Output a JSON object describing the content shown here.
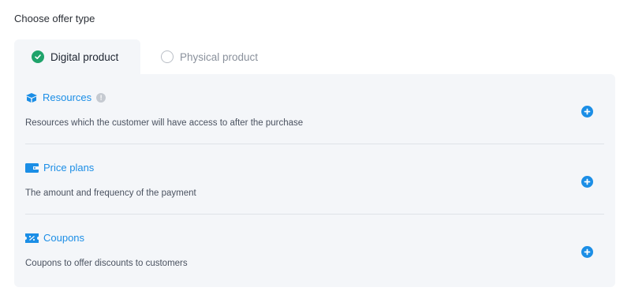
{
  "header": {
    "title": "Choose offer type"
  },
  "tabs": [
    {
      "label": "Digital product",
      "selected": true
    },
    {
      "label": "Physical product",
      "selected": false
    }
  ],
  "sections": [
    {
      "title": "Resources",
      "description": "Resources which the customer will have access to after the purchase",
      "icon": "box-icon",
      "has_info": true
    },
    {
      "title": "Price plans",
      "description": "The amount and frequency of the payment",
      "icon": "wallet-icon",
      "has_info": false
    },
    {
      "title": "Coupons",
      "description": "Coupons to offer discounts to customers",
      "icon": "coupon-icon",
      "has_info": false
    }
  ],
  "colors": {
    "accent": "#1b8ee6",
    "selected_check": "#1fa36b",
    "panel_bg": "#f4f6f9"
  }
}
